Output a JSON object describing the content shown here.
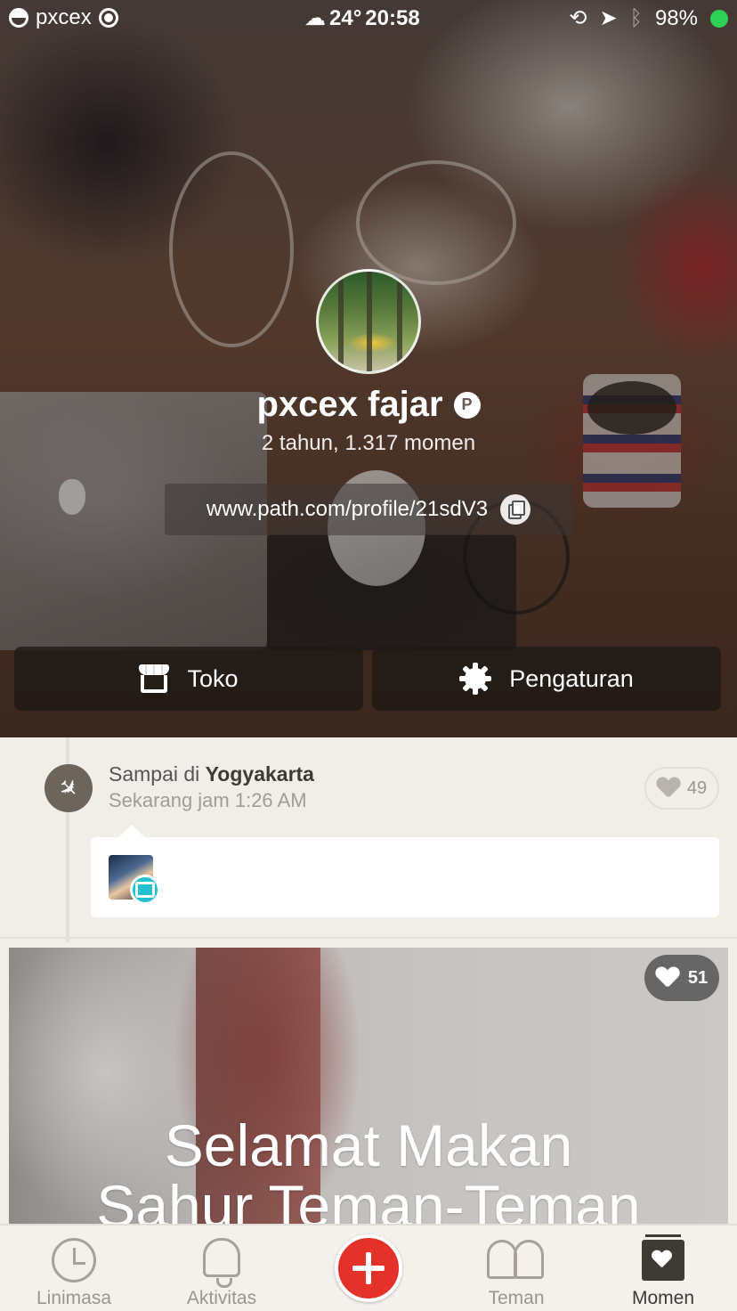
{
  "status_bar": {
    "carrier": "pxcex",
    "weather": "24°",
    "time": "20:58",
    "battery": "98%"
  },
  "profile": {
    "name": "pxcex fajar",
    "stats": "2 tahun, 1.317 momen",
    "url": "www.path.com/profile/21sdV3",
    "shop_label": "Toko",
    "settings_label": "Pengaturan"
  },
  "feed": {
    "checkin": {
      "prefix": "Sampai di",
      "place": "Yogyakarta",
      "subtitle": "Sekarang jam 1:26 AM",
      "likes": "49"
    },
    "photo": {
      "likes": "51",
      "overlay_line1": "Selamat Makan",
      "overlay_line2": "Sahur Teman-Teman"
    }
  },
  "tabbar": {
    "tabs": [
      {
        "label": "Linimasa",
        "icon": "clock-icon"
      },
      {
        "label": "Aktivitas",
        "icon": "bell-icon"
      },
      {
        "label": "",
        "icon": "plus-icon"
      },
      {
        "label": "Teman",
        "icon": "friends-icon"
      },
      {
        "label": "Momen",
        "icon": "moments-icon"
      }
    ],
    "active_tab": "Momen"
  },
  "colors": {
    "accent_red": "#e4322a",
    "camera_badge": "#22c1d0",
    "battery_green": "#2ed158"
  }
}
